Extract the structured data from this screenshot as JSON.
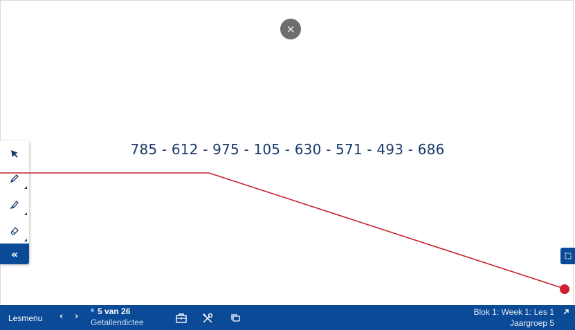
{
  "close_button": {
    "label": "×",
    "icon": "close-icon"
  },
  "content": {
    "numbers_text": "785 - 612 - 975 - 105 - 630 - 571 - 493 - 686"
  },
  "toolbar": {
    "tools": [
      {
        "icon": "pointer-arrow-icon"
      },
      {
        "icon": "pencil-icon"
      },
      {
        "icon": "marker-icon"
      },
      {
        "icon": "eraser-icon"
      }
    ],
    "collapse_label": "«"
  },
  "bottom_bar": {
    "lesmenu_label": "Lesmenu",
    "prev_label": "‹",
    "next_label": "›",
    "progress_label": "5 van 26",
    "lesson_title": "Getallendictee",
    "icons": [
      "briefcase-icon",
      "tools-icon",
      "copy-icon"
    ],
    "blok_label": "Blok 1: Week 1: Les 1",
    "jaargroep_label": "Jaargroep 5",
    "colors": {
      "bar": "#0a4a96",
      "progress_dot": "#5fb4ff"
    }
  },
  "annotation": {
    "line_color": "#c4202f"
  }
}
